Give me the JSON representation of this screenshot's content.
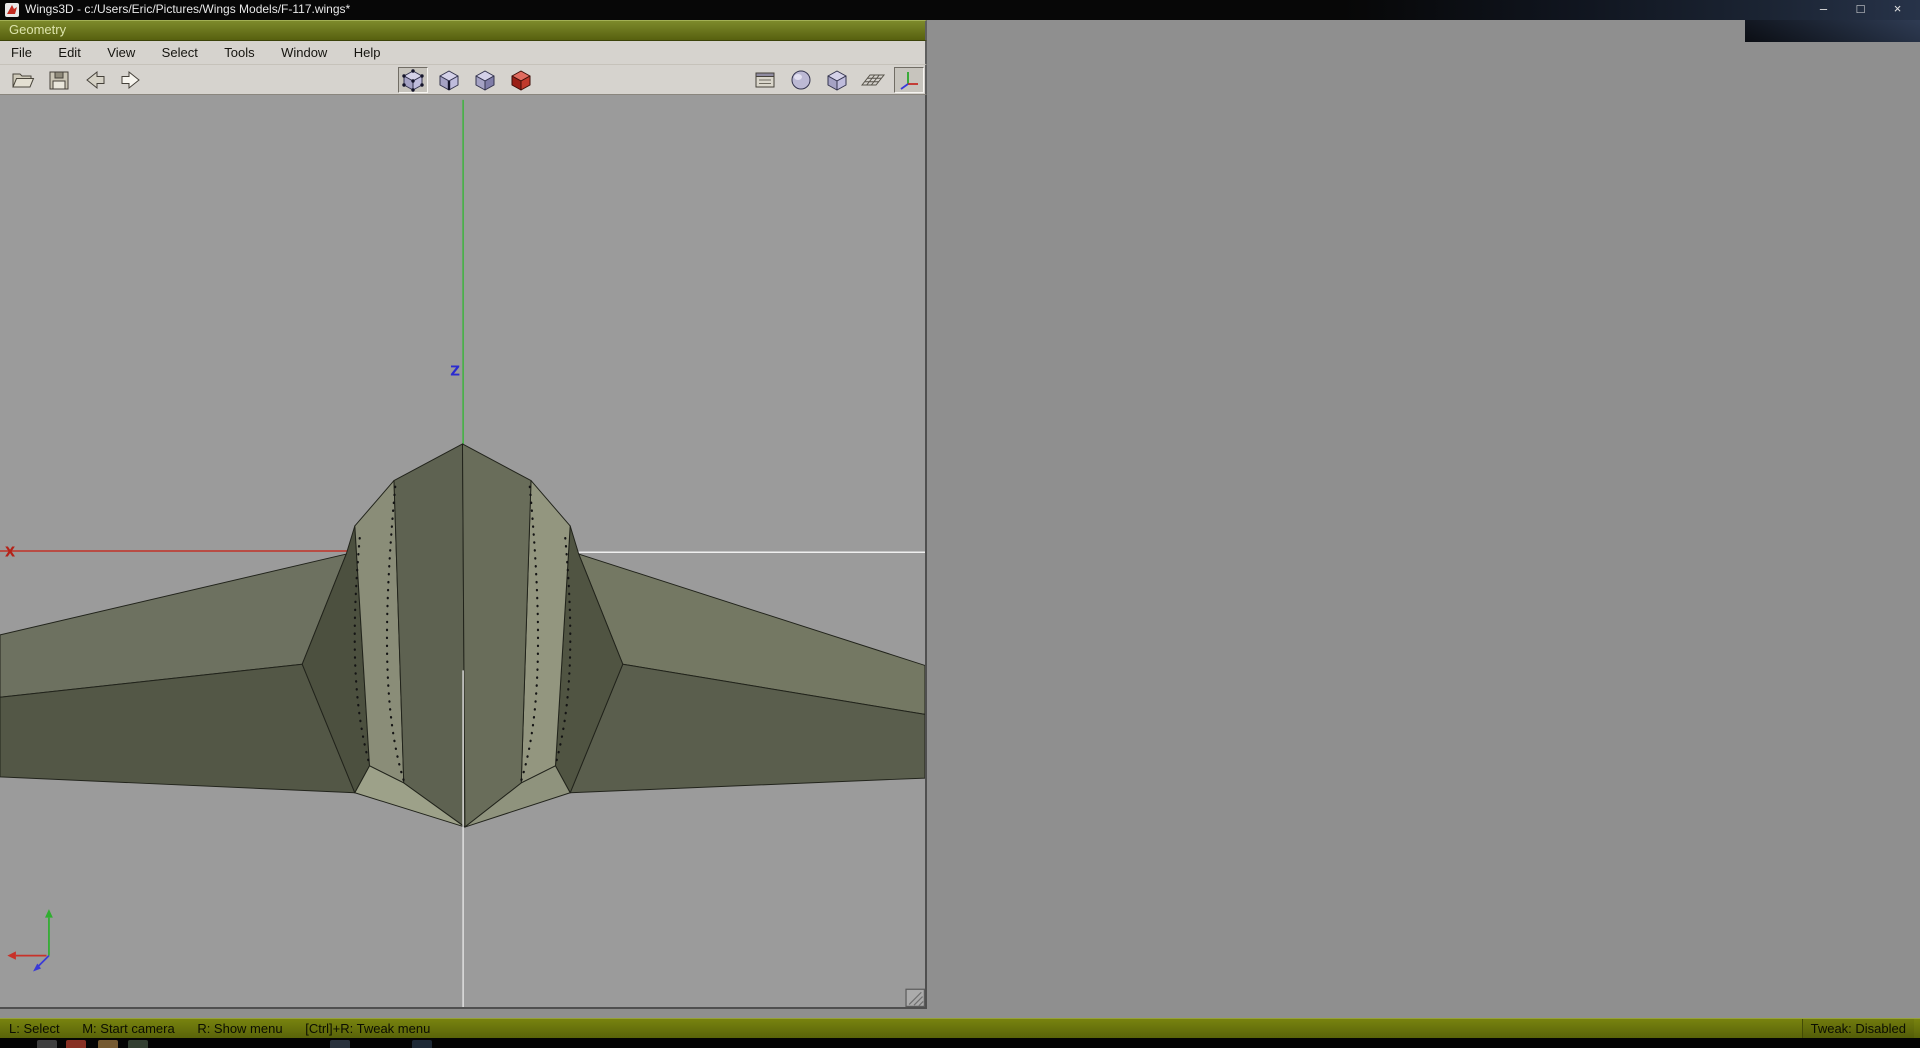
{
  "title_bar": {
    "title": "Wings3D - c:/Users/Eric/Pictures/Wings Models/F-117.wings*",
    "controls": {
      "minimize": "–",
      "restore": "□",
      "close": "×"
    }
  },
  "geometry_window": {
    "title": "Geometry"
  },
  "menu_bar": {
    "items": [
      "File",
      "Edit",
      "View",
      "Select",
      "Tools",
      "Window",
      "Help"
    ]
  },
  "toolbar": {
    "file_group": [
      "open",
      "save",
      "undo",
      "redo"
    ],
    "mode_group": [
      "vertex",
      "edge",
      "face",
      "body"
    ],
    "view_group": [
      "windows",
      "smooth-preview",
      "orthographic-view",
      "ground-plane",
      "axes"
    ],
    "active_mode": "vertex",
    "active_view_toggle": "axes"
  },
  "viewport": {
    "axis_x_label": "X",
    "axis_z_label": "Z"
  },
  "status_bar": {
    "hints": [
      "L: Select",
      "M: Start camera",
      "R: Show menu",
      "[Ctrl]+R: Tweak menu"
    ],
    "tweak_status": "Tweak: Disabled"
  },
  "colors": {
    "header_olive": "#6d7820",
    "status_olive": "#6b7610",
    "viewport_gray": "#9b9b9b",
    "desktop_gray": "#8f8f8f",
    "model_olive": "#6d7160",
    "axis_green": "#3cb43c",
    "axis_red": "#c23228",
    "axis_blue": "#2c2cd0"
  }
}
